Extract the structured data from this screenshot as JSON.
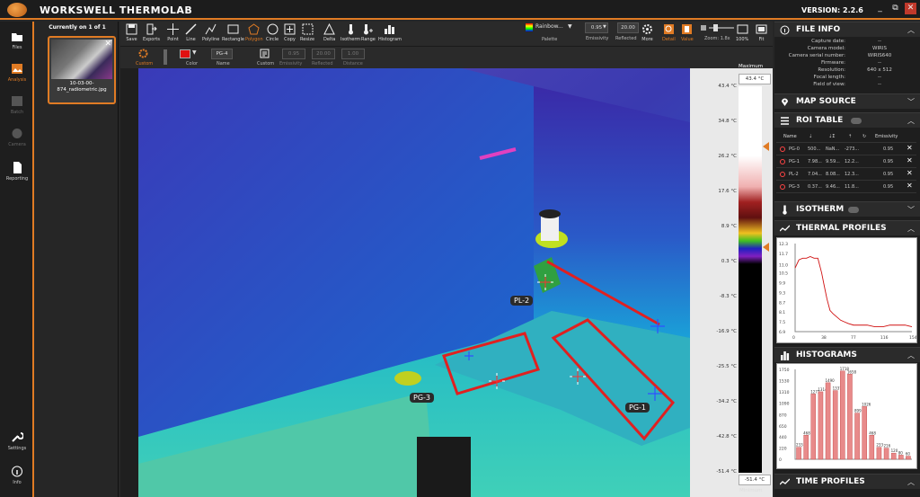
{
  "app": {
    "title": "WORKSWELL THERMOLAB",
    "version": "VERSION: 2.2.6",
    "colors": {
      "accent": "#e07b24",
      "roi": "#e02020"
    }
  },
  "window_controls": {
    "minimize": "_",
    "maximize": "⧉",
    "close": "✕"
  },
  "nav": [
    {
      "label": "Files",
      "icon": "folder-icon"
    },
    {
      "label": "Analysis",
      "icon": "image-icon"
    },
    {
      "label": "Batch",
      "icon": "batch-icon"
    },
    {
      "label": "Camera",
      "icon": "camera-icon"
    },
    {
      "label": "Reporting",
      "icon": "document-icon"
    },
    {
      "label": "Settings",
      "icon": "wrench-icon"
    },
    {
      "label": "Info",
      "icon": "info-icon"
    }
  ],
  "files": {
    "header": "Currently on 1 of 1",
    "thumb_caption": "10-03-00-874_radiometric.jpg",
    "close": "✕"
  },
  "toolbar": {
    "tools": [
      "Save",
      "Exports",
      "Point",
      "Line",
      "Polyline",
      "Rectangle",
      "Polygon",
      "Circle",
      "Copy",
      "Resize",
      "Delta",
      "Isotherm",
      "Range",
      "Histogram"
    ],
    "palette_value": "Rainbow...",
    "palette_label": "Palette",
    "emissivity_value": "0.95",
    "emissivity_label": "Emissivity",
    "reflected_value": "20.00",
    "reflected_label": "Reflected",
    "more_label": "More",
    "detail_label": "Detail",
    "value_label": "Value",
    "zoom_label": "Zoom: 1.8x",
    "zoom100_label": "100%",
    "fit_label": "Fit"
  },
  "subbar": {
    "custom1": "Custom",
    "color_label": "Color",
    "name_value": "PG-4",
    "name_label": "Name",
    "custom2": "Custom",
    "emissivity_value": "0.95",
    "emissivity_label": "Emissivity",
    "reflected_value": "20.00",
    "reflected_label": "Reflected",
    "distance_value": "1.00",
    "distance_label": "Distance"
  },
  "roi_labels": {
    "pl2": "PL-2",
    "pg3": "PG-3",
    "pg1": "PG-1"
  },
  "scale": {
    "max_label": "Maximum",
    "max_value": "43.4 °C",
    "min_label": "Minimum",
    "min_value": "-51.4 °C",
    "ticks": [
      "43.4 °C",
      "34.8 °C",
      "26.2 °C",
      "17.6 °C",
      "8.9 °C",
      "0.3 °C",
      "-8.3 °C",
      "-16.9 °C",
      "-25.5 °C",
      "-34.2 °C",
      "-42.8 °C",
      "-51.4 °C"
    ]
  },
  "file_info": {
    "title": "FILE INFO",
    "rows": [
      {
        "k": "Capture date:",
        "v": "--"
      },
      {
        "k": "Camera model:",
        "v": "WIRIS"
      },
      {
        "k": "Camera serial number:",
        "v": "WIRIS640"
      },
      {
        "k": "Firmware:",
        "v": "--"
      },
      {
        "k": "Resolution:",
        "v": "640 x 512"
      },
      {
        "k": "Focal length:",
        "v": "--"
      },
      {
        "k": "Field of view:",
        "v": "--"
      }
    ]
  },
  "map_source": {
    "title": "MAP SOURCE"
  },
  "roi_table": {
    "title": "ROI TABLE",
    "headers": [
      "Name",
      "",
      "",
      "",
      "",
      "Emissivity"
    ],
    "rows": [
      {
        "name": "PG-0",
        "c1": "500...",
        "c2": "NaN...",
        "c3": "-273...",
        "e": "0.95"
      },
      {
        "name": "PG-1",
        "c1": "7.98...",
        "c2": "9.59...",
        "c3": "12.2...",
        "e": "0.95"
      },
      {
        "name": "PL-2",
        "c1": "7.04...",
        "c2": "8.08...",
        "c3": "12.3...",
        "e": "0.95"
      },
      {
        "name": "PG-3",
        "c1": "0.37...",
        "c2": "9.46...",
        "c3": "11.8...",
        "e": "0.95"
      }
    ],
    "delete": "✕"
  },
  "isotherm": {
    "title": "ISOTHERM"
  },
  "thermal_profiles": {
    "title": "THERMAL PROFILES",
    "yticks": [
      "12.3",
      "11.7",
      "11.0",
      "10.5",
      "9.9",
      "9.3",
      "8.7",
      "8.1",
      "7.5",
      "6.9"
    ],
    "xticks": [
      "0",
      "38",
      "77",
      "116",
      "154"
    ]
  },
  "histograms": {
    "title": "HISTOGRAMS",
    "yticks": [
      "1750",
      "1530",
      "1310",
      "1090",
      "870",
      "650",
      "440",
      "220",
      "0"
    ],
    "bar_labels": [
      "1271",
      "1314",
      "1490",
      "1337",
      "1718",
      "1658",
      "899",
      "1026",
      "468",
      "233",
      "216"
    ]
  },
  "time_profiles": {
    "title": "TIME PROFILES"
  },
  "chart_data": [
    {
      "type": "line",
      "title": "THERMAL PROFILES",
      "xlabel": "",
      "ylabel": "",
      "xlim": [
        0,
        154
      ],
      "ylim": [
        6.9,
        12.3
      ],
      "x": [
        0,
        5,
        10,
        15,
        20,
        25,
        30,
        35,
        38,
        42,
        46,
        50,
        55,
        60,
        65,
        70,
        77,
        85,
        95,
        105,
        116,
        125,
        135,
        145,
        154
      ],
      "series": [
        {
          "values": [
            10.8,
            11.3,
            11.4,
            11.4,
            11.5,
            11.4,
            11.4,
            10.5,
            9.8,
            8.9,
            8.2,
            8.0,
            7.8,
            7.6,
            7.5,
            7.4,
            7.3,
            7.3,
            7.3,
            7.2,
            7.2,
            7.3,
            7.3,
            7.3,
            7.2
          ]
        }
      ]
    },
    {
      "type": "bar",
      "title": "HISTOGRAMS",
      "ylim": [
        0,
        1750
      ],
      "values": [
        233,
        468,
        1271,
        1314,
        1490,
        1337,
        1718,
        1658,
        899,
        1026,
        468,
        233,
        216,
        120,
        80,
        60
      ]
    }
  ]
}
